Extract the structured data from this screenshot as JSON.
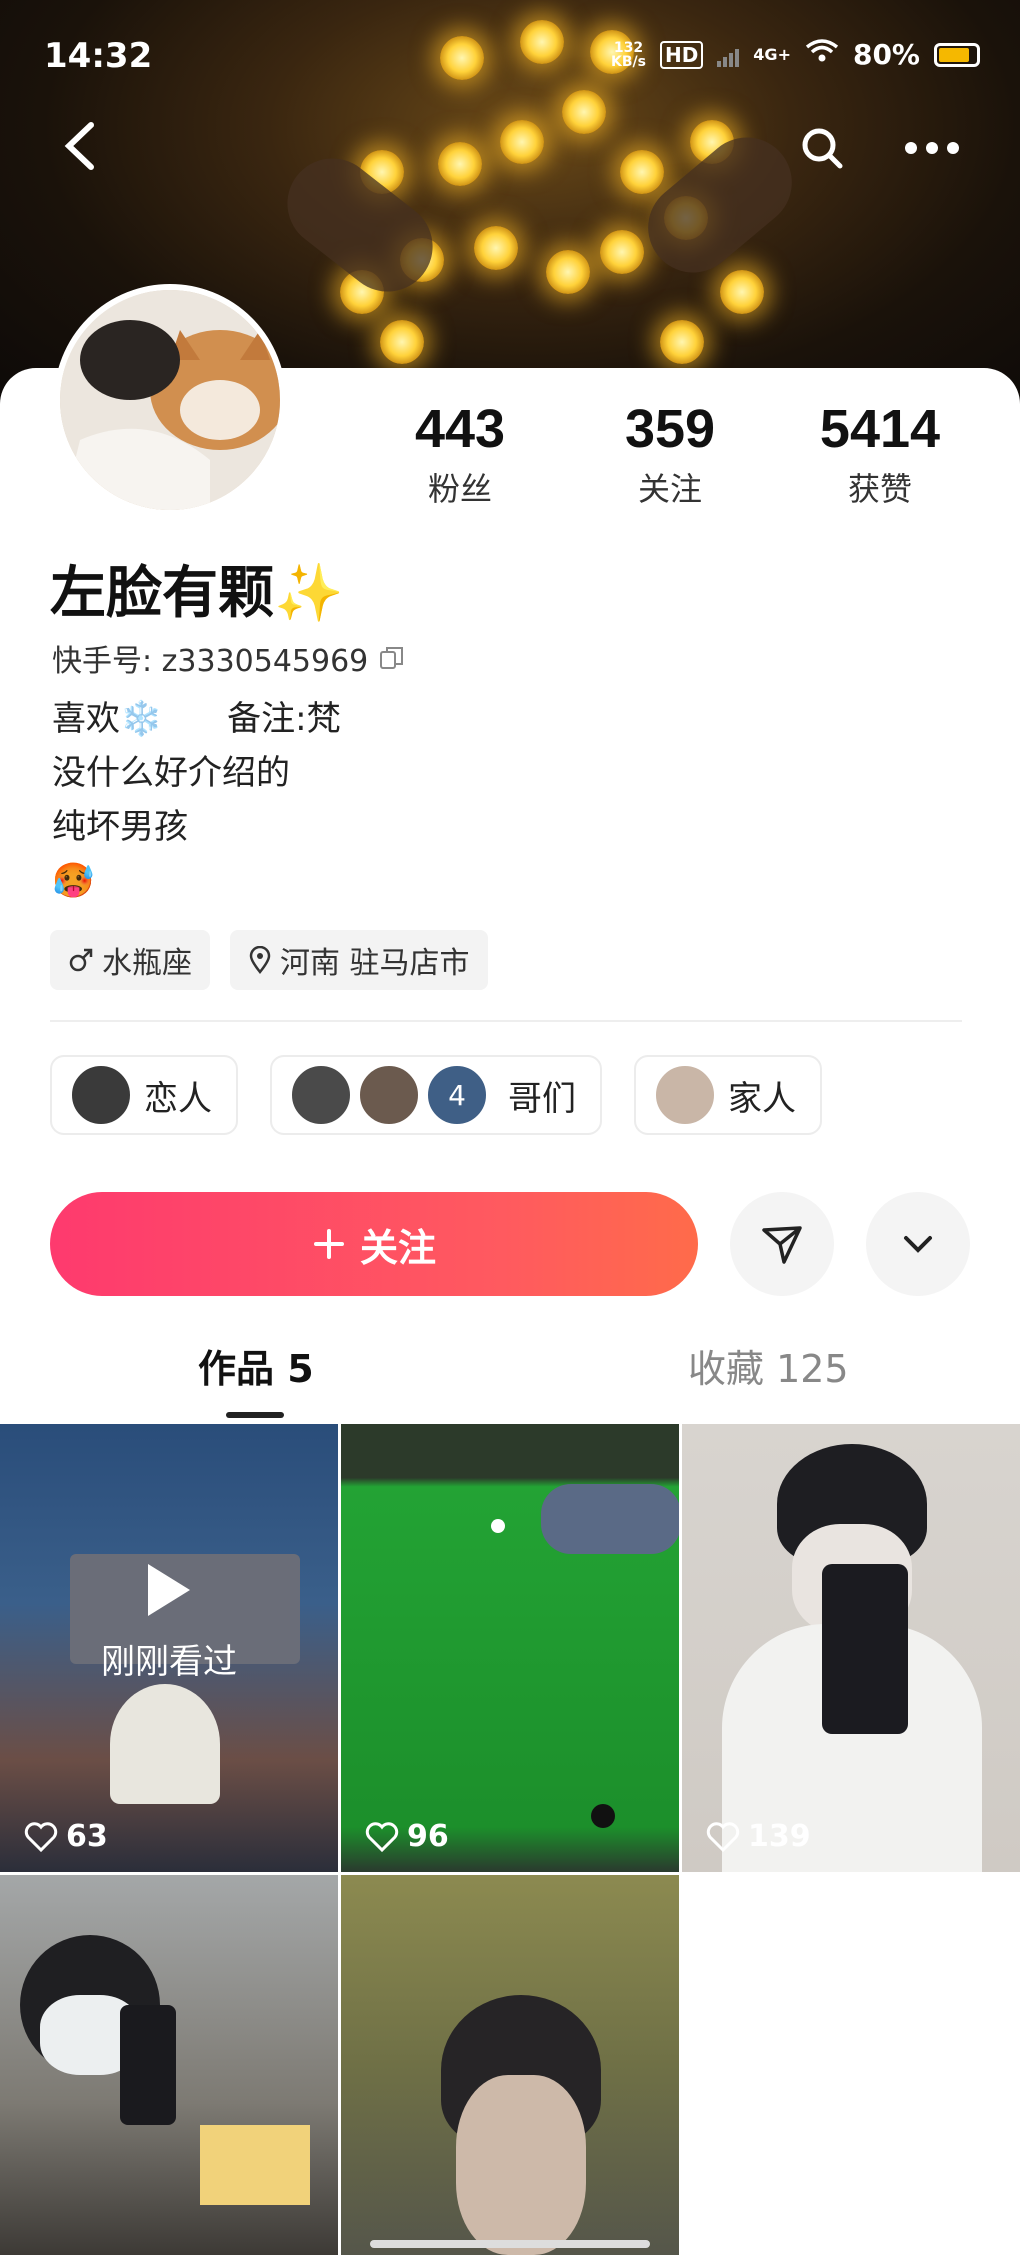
{
  "status_bar": {
    "time": "14:32",
    "net_speed": "132",
    "net_unit": "KB/s",
    "hd": "HD",
    "signal": "4G+",
    "battery": "80%"
  },
  "profile": {
    "name": "左脸有颗✨",
    "id_text": "快手号: z3330545969",
    "bio": [
      "喜欢❄️      备注:梵",
      "没什么好介绍的",
      "纯坏男孩",
      "🥵"
    ],
    "tags": [
      {
        "icon": "male-icon",
        "label": "水瓶座"
      },
      {
        "icon": "location-icon",
        "label": "河南 驻马店市"
      }
    ],
    "stats": [
      {
        "num": "443",
        "label": "粉丝"
      },
      {
        "num": "359",
        "label": "关注"
      },
      {
        "num": "5414",
        "label": "获赞"
      }
    ]
  },
  "groups": [
    {
      "label": "恋人"
    },
    {
      "label": "哥们",
      "count": "4"
    },
    {
      "label": "家人"
    }
  ],
  "actions": {
    "follow_label": "关注"
  },
  "tabs": [
    {
      "label": "作品 5"
    },
    {
      "label": "收藏 125"
    }
  ],
  "posts": [
    {
      "likes": "63",
      "watched": "刚刚看过",
      "bg": "#2b4a6a"
    },
    {
      "likes": "96",
      "bg": "#1f8f2a"
    },
    {
      "likes": "139",
      "bg": "#c9c6c2"
    },
    {
      "bg": "#7d7a73"
    },
    {
      "bg": "#8a8a62"
    }
  ],
  "colors": {
    "accent": "#fe3a6e",
    "accent_end": "#ff6b4a"
  }
}
